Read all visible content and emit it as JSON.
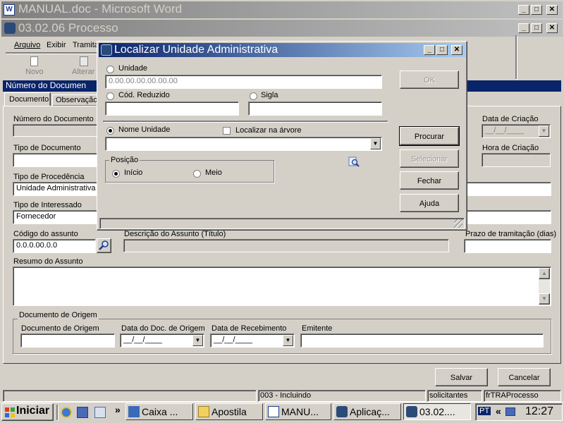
{
  "word": {
    "title": "MANUAL.doc - Microsoft Word"
  },
  "processo": {
    "title": "03.02.06 Processo",
    "menu": [
      "Arquivo",
      "Exibir",
      "Tramita"
    ],
    "toolbar": {
      "novo": "Novo",
      "alterar": "Alterar"
    },
    "section_header": "Número do Documen",
    "tabs": [
      "Documento",
      "Observação"
    ],
    "labels": {
      "numero_documento": "Número do Documento",
      "tipo_documento": "Tipo de Documento",
      "tipo_procedencia": "Tipo de Procedência",
      "tipo_interessado": "Tipo de Interessado",
      "codigo_assunto": "Código do assunto",
      "descricao_assunto": "Descrição do Assunto (Título)",
      "prazo_tramitacao": "Prazo de tramitação (dias)",
      "resumo_assunto": "Resumo do Assunto",
      "data_criacao": "Data de Criação",
      "hora_criacao": "Hora de Criação"
    },
    "values": {
      "tipo_procedencia": "Unidade Administrativa",
      "tipo_interessado": "Fornecedor",
      "codigo_assunto": "0.0.0.00.0.0",
      "data_criacao": "__/__/____"
    },
    "origem": {
      "group_title": "Documento de Origem",
      "labels": {
        "documento_origem": "Documento de Origem",
        "data_doc_origem": "Data do Doc. de Origem",
        "data_recebimento": "Data de Recebimento",
        "emitente": "Emitente"
      },
      "data_doc_origem": "__/__/____",
      "data_recebimento": "__/__/____"
    },
    "buttons": {
      "salvar": "Salvar",
      "cancelar": "Cancelar"
    },
    "status": [
      "003 - Incluindo",
      "solicitantes",
      "frTRAProcesso"
    ]
  },
  "dialog": {
    "title": "Localizar Unidade Administrativa",
    "radio_unidade": "Unidade",
    "unidade_value": "0.00.00.00.00.00.00",
    "radio_cod_reduzido": "Cód. Reduzido",
    "radio_sigla": "Sigla",
    "radio_nome_unidade": "Nome Unidade",
    "check_localizar": "Localizar na árvore",
    "posicao_title": "Posição",
    "posicao_inicio": "Início",
    "posicao_meio": "Meio",
    "buttons": {
      "ok": "OK",
      "procurar": "Procurar",
      "selecionar": "Selecionar",
      "fechar": "Fechar",
      "ajuda": "Ajuda"
    }
  },
  "taskbar": {
    "start": "Iniciar",
    "items": [
      "Caixa ...",
      "Apostila",
      "MANU...",
      "Aplicaç...",
      "03.02...."
    ],
    "lang": "PT",
    "chevron": "«",
    "clock": "12:27"
  },
  "colors": {
    "titlebar": "#0a246a",
    "titlebar_end": "#a6caf0",
    "inactive": "#808080",
    "face": "#d4d0c8",
    "desktop": "#3a6ea5"
  }
}
